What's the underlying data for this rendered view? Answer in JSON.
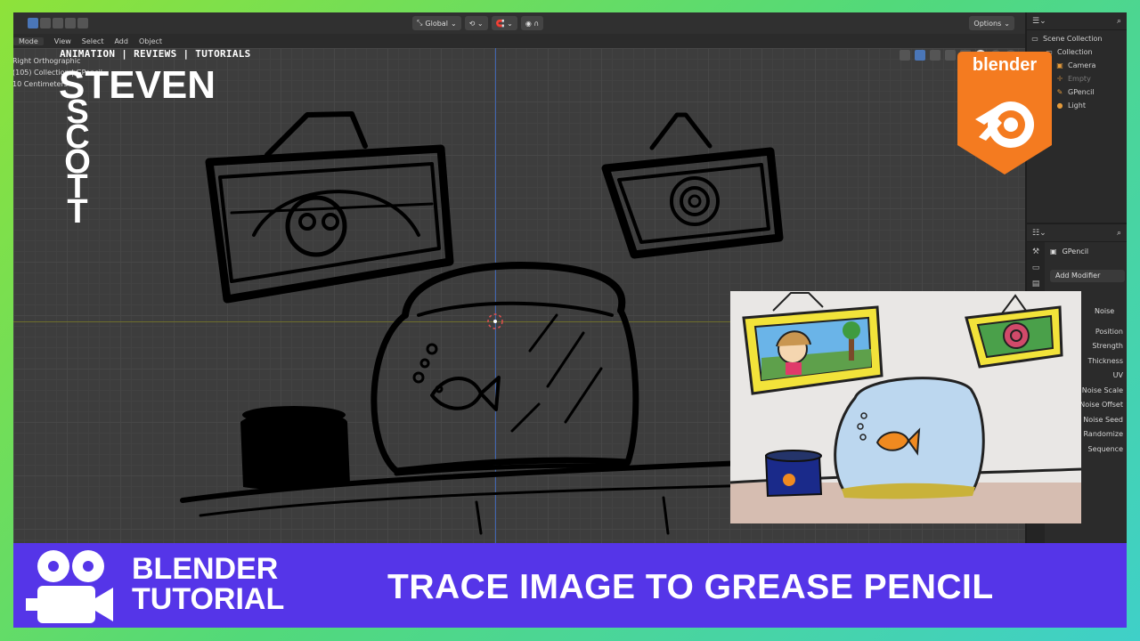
{
  "header": {
    "transform_orientation": "Global",
    "options_label": "Options"
  },
  "mode_menu": {
    "mode": "Mode",
    "items": [
      "View",
      "Select",
      "Add",
      "Object"
    ]
  },
  "viewport": {
    "view_name": "Right Orthographic",
    "collection_info": "(105) Collection | GPencil",
    "scale": "10 Centimeters"
  },
  "outliner": {
    "root": "Scene Collection",
    "collection": "Collection",
    "items": [
      {
        "label": "Camera",
        "dim": false
      },
      {
        "label": "Empty",
        "dim": true
      },
      {
        "label": "GPencil",
        "dim": false
      },
      {
        "label": "Light",
        "dim": false
      }
    ]
  },
  "properties": {
    "object_name": "GPencil",
    "add_modifier": "Add Modifier",
    "modifier_name": "Noise",
    "rows": [
      "Position",
      "Strength",
      "Thickness",
      "UV",
      "Noise Scale",
      "Noise Offset",
      "Noise Seed",
      "Randomize",
      "Sequence"
    ]
  },
  "branding": {
    "subtitle": "ANIMATION | REVIEWS | TUTORIALS",
    "name_first": "STEVEN",
    "name_last_letters": [
      "S",
      "C",
      "O",
      "T",
      "T"
    ],
    "badge_text": "blender",
    "badge_color": "#f47b20"
  },
  "banner": {
    "title_line1": "BLENDER",
    "title_line2": "TUTORIAL",
    "headline": "TRACE IMAGE TO GREASE PENCIL",
    "background_color": "#5535e8"
  }
}
